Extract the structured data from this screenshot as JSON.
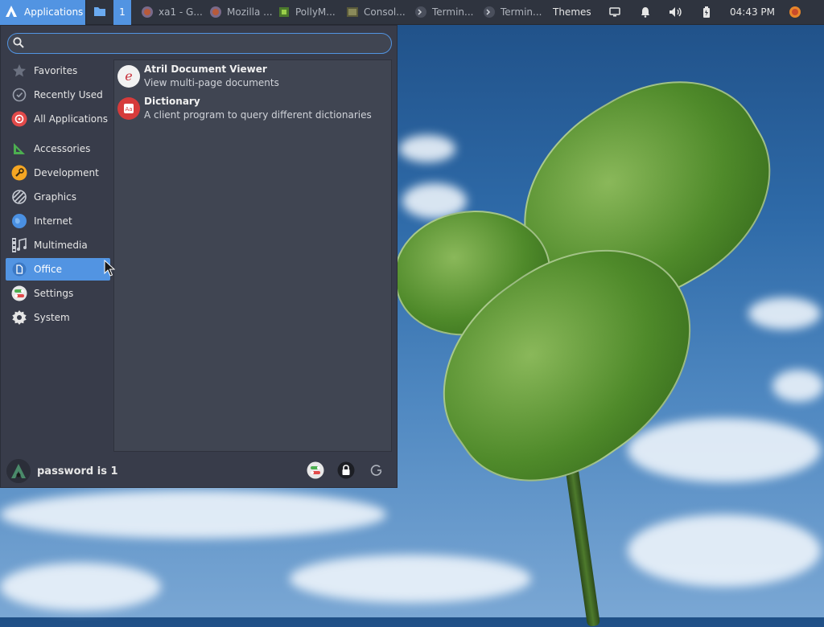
{
  "panel": {
    "applications_label": "Applications",
    "workspace_number": "1",
    "tasks": [
      {
        "label": "xa1 - G..."
      },
      {
        "label": "Mozilla ..."
      },
      {
        "label": "PollyM..."
      },
      {
        "label": "Consol..."
      },
      {
        "label": "Termin..."
      },
      {
        "label": "Termin..."
      }
    ],
    "themes_label": "Themes",
    "clock": "04:43 PM"
  },
  "menu": {
    "search": {
      "value": "",
      "placeholder": ""
    },
    "categories": [
      {
        "label": "Favorites",
        "icon": "star-icon"
      },
      {
        "label": "Recently Used",
        "icon": "clock-icon"
      },
      {
        "label": "All Applications",
        "icon": "all-apps-icon"
      },
      {
        "label": "Accessories",
        "icon": "accessories-icon"
      },
      {
        "label": "Development",
        "icon": "wrench-icon"
      },
      {
        "label": "Graphics",
        "icon": "graphics-icon"
      },
      {
        "label": "Internet",
        "icon": "globe-icon"
      },
      {
        "label": "Multimedia",
        "icon": "multimedia-icon"
      },
      {
        "label": "Office",
        "icon": "document-icon",
        "selected": true
      },
      {
        "label": "Settings",
        "icon": "settings-toggle-icon"
      },
      {
        "label": "System",
        "icon": "gear-icon"
      }
    ],
    "apps": [
      {
        "name": "Atril Document Viewer",
        "description": "View multi-page documents",
        "icon": "atril-icon"
      },
      {
        "name": "Dictionary",
        "description": "A client program to query different dictionaries",
        "icon": "dictionary-icon"
      }
    ],
    "footer": {
      "username": "password is 1",
      "buttons": [
        "settings-manager-icon",
        "lock-screen-icon",
        "logout-icon"
      ]
    }
  },
  "colors": {
    "accent": "#5294e2",
    "panel_bg": "#2f343f",
    "menu_bg": "#383c4a",
    "list_bg": "#404552"
  }
}
